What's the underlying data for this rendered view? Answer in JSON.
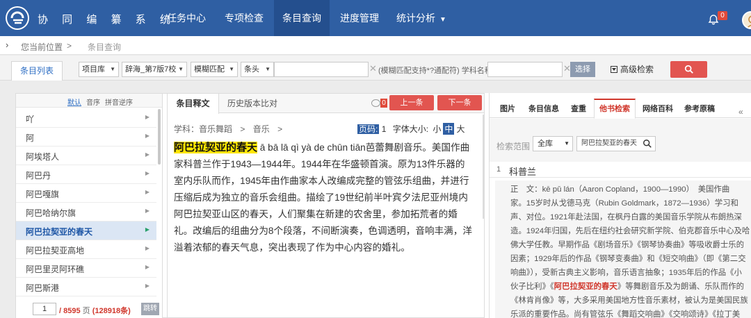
{
  "nav": {
    "title": "协 同 编 纂 系 统",
    "items": [
      "任务中心",
      "专项检查",
      "条目查询",
      "进度管理",
      "统计分析"
    ],
    "left_arrow": "‹",
    "right_arrow": "›",
    "caret": "▼",
    "bell_badge": "0"
  },
  "breadcrumb": {
    "arrow": "›",
    "location": "您当前位置",
    "sep": ">",
    "current": "条目查询"
  },
  "toolbar": {
    "tab": "条目列表",
    "selects": [
      "项目库",
      "辞海_第7版7校",
      "模糊匹配",
      "条头"
    ],
    "select_caret": "▼",
    "clear": "✕",
    "hint": "(模糊匹配支持*?通配符) 学科名称",
    "choose": "选择",
    "advanced": "高级检索"
  },
  "left": {
    "sort": [
      "默认",
      "音序",
      "拼音逆序"
    ],
    "entry_arrow": "▶",
    "entries": [
      "吖",
      "阿",
      "阿埃塔人",
      "阿巴丹",
      "阿巴嘎旗",
      "阿巴哈纳尔旗",
      "阿巴拉契亚的春天",
      "阿巴拉契亚高地",
      "阿巴里灵阿环礁",
      "阿巴斯港"
    ],
    "selected_index": 6,
    "page_value": "1",
    "total": "/ 8595",
    "page_unit": "页",
    "count": "(128918条)",
    "go": "跳转"
  },
  "middle": {
    "tabs": [
      "条目释文",
      "历史版本比对"
    ],
    "comment_badge": "0",
    "prev": "上一条",
    "next": "下一条",
    "subject": "学科：音乐舞蹈",
    "sep": ">",
    "subject2": "音乐",
    "sep2": ">",
    "page_label": "页码:",
    "page_value": "1",
    "font_label": "字体大小:",
    "font_sizes": [
      "小",
      "中",
      "大"
    ],
    "headword": "阿巴拉契亚的春天",
    "definition": " ā bā lā qì yà de chūn tiān芭蕾舞剧音乐。美国作曲家科普兰作于1943—1944年。1944年在华盛顿首演。原为13件乐器的室内乐队而作，1945年由作曲家本人改编成完整的管弦乐组曲，并进行压缩后成为独立的音乐会组曲。描绘了19世纪前半叶宾夕法尼亚州境内阿巴拉契亚山区的春天，人们聚集在新建的农舍里，参加拓荒者的婚礼。改编后的组曲分为8个段落，不间断演奏，色调透明，音响丰满，洋溢着浓郁的春天气息，突出表现了作为中心内容的婚礼。"
  },
  "right": {
    "tabs": [
      "图片",
      "条目信息",
      "查重",
      "他书检索",
      "网络百科",
      "参考原稿"
    ],
    "active_tab": 3,
    "collapse": "«",
    "scope_label": "检索范围",
    "scope_value": "全库",
    "scope_caret": "▼",
    "scope_query": "阿巴拉契亚的春天",
    "result_index": "1",
    "result_title": "科普兰",
    "lines": [
      "正　文：kē pǔ lán（Aaron Copland，1900—1990）　美国作曲",
      "家。15岁时从戈德马克（Rubin Goldmark，1872—1936）学习和",
      "声、对位。1921年赴法国，在枫丹白露的美国音乐学院从布朗热深",
      "造。1924年归国，先后在纽约社会研究新学院、伯克郡音乐中心及哈",
      "佛大学任教。早期作品《剧场音乐》《钢琴协奏曲》等吸收爵士乐的",
      "因素；1929年后的作品《钢琴变奏曲》和《短交响曲》（即《第二交",
      "响曲》），受新古典主义影响，音乐语言抽象；1935年后的作品《小",
      "伙子比利》《",
      "《林肯肖像》等，大多采用美国地方性音乐素材，被认为是美国民族",
      "乐派的重要作品。尚有管弦乐《舞蹈交响曲》《交响颂诗》《拉丁美"
    ],
    "line8_hl": "阿巴拉契亚的春天",
    "line8_tail": "》等舞剧音乐及为朗诵、乐队而作的"
  }
}
